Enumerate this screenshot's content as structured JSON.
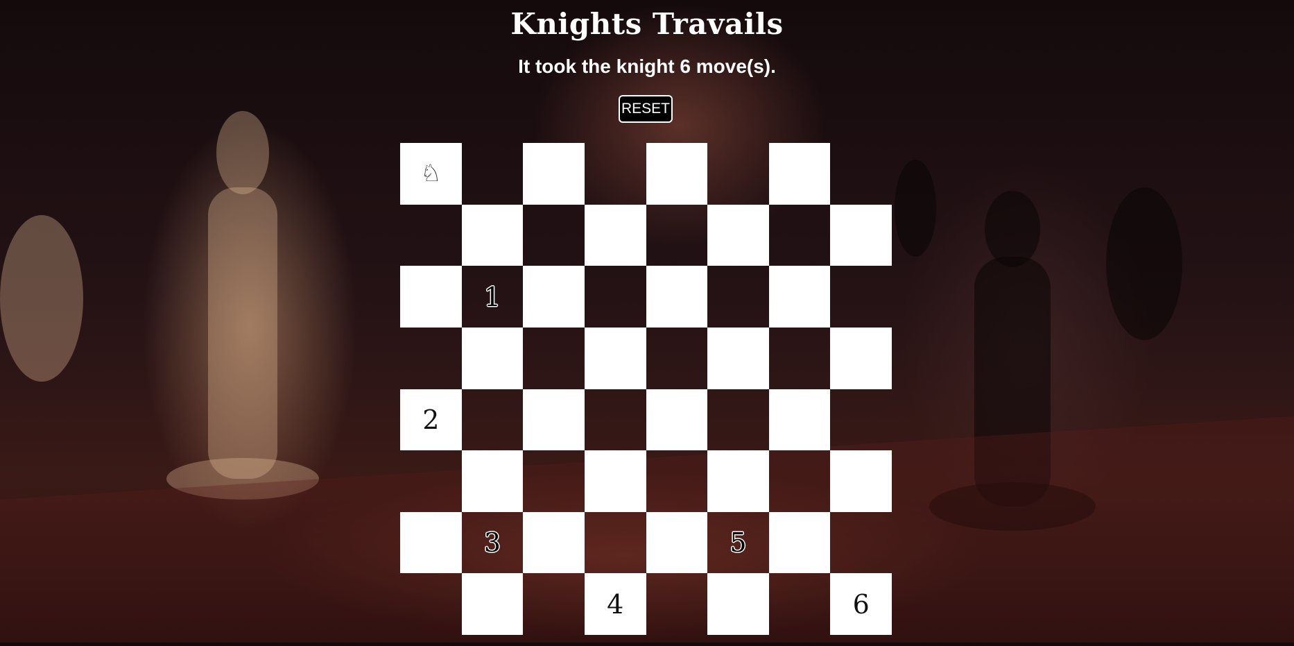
{
  "app": {
    "title": "Knights Travails",
    "status": "It took the knight 6 move(s).",
    "reset_label": "RESET"
  },
  "board": {
    "size": 8,
    "light_color": "#ffffff",
    "knight_glyph": "♘",
    "knight_start": {
      "row": 0,
      "col": 0
    },
    "path": [
      {
        "row": 2,
        "col": 1,
        "label": "1"
      },
      {
        "row": 4,
        "col": 0,
        "label": "2"
      },
      {
        "row": 6,
        "col": 1,
        "label": "3"
      },
      {
        "row": 7,
        "col": 3,
        "label": "4"
      },
      {
        "row": 6,
        "col": 5,
        "label": "5"
      },
      {
        "row": 7,
        "col": 7,
        "label": "6"
      }
    ]
  }
}
